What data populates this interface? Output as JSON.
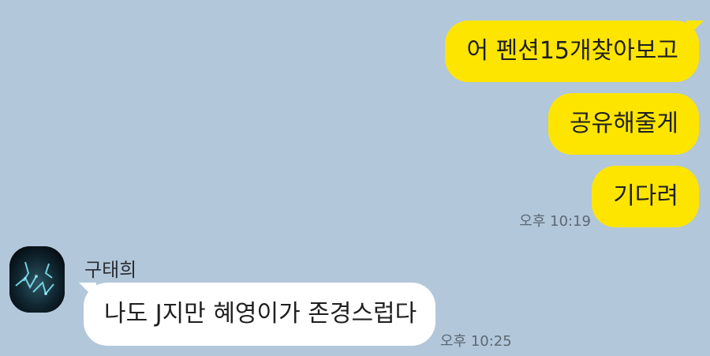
{
  "chat": {
    "background_color": "#b2c7da",
    "outgoing_bubble_color": "#fee500",
    "incoming_bubble_color": "#ffffff",
    "messages_out": [
      {
        "text": "어 펜션15개찾아보고"
      },
      {
        "text": "공유해줄게"
      },
      {
        "text": "기다려"
      }
    ],
    "out_time": "오후 10:19",
    "incoming": {
      "sender": "구태희",
      "text": "나도 J지만 혜영이가 존경스럽다",
      "time": "오후 10:25"
    }
  }
}
